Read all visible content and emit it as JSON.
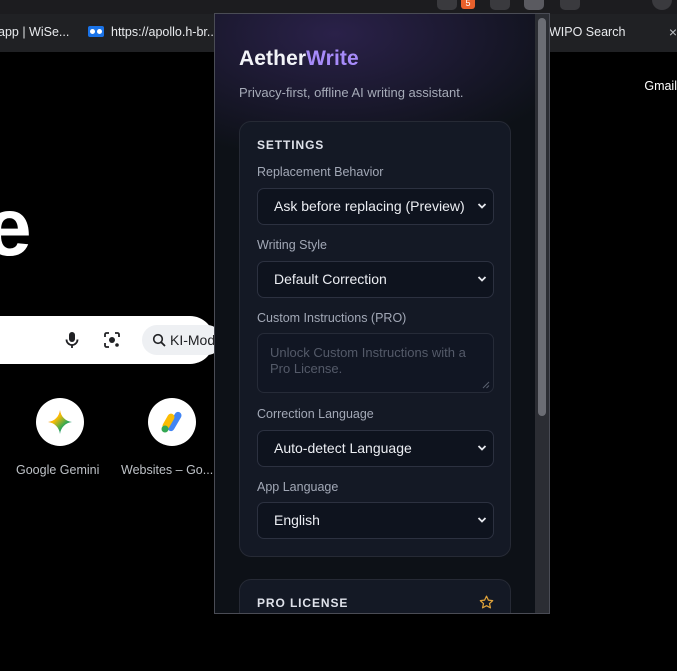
{
  "browser": {
    "extension_badge": "5",
    "bookmarks": [
      {
        "label": "app | WiSe..."
      },
      {
        "label": "https://apollo.h-br..."
      },
      {
        "label": "WIPO Search"
      }
    ],
    "close_symbol": "×",
    "gmail": "Gmail",
    "logo_letter": "e",
    "search_chip": "KI-Modus",
    "shortcuts": [
      {
        "label": "Google Gemini"
      },
      {
        "label": "Websites – Go..."
      }
    ]
  },
  "popup": {
    "brand_part1": "Aether",
    "brand_part2": "Write",
    "tagline": "Privacy-first, offline AI writing assistant.",
    "settings": {
      "title": "SETTINGS",
      "replacement_behavior": {
        "label": "Replacement Behavior",
        "value": "Ask before replacing (Preview)"
      },
      "writing_style": {
        "label": "Writing Style",
        "value": "Default Correction"
      },
      "custom_instructions": {
        "label": "Custom Instructions (PRO)",
        "placeholder": "Unlock Custom Instructions with a Pro License."
      },
      "correction_language": {
        "label": "Correction Language",
        "value": "Auto-detect Language"
      },
      "app_language": {
        "label": "App Language",
        "value": "English"
      }
    },
    "pro": {
      "title": "PRO LICENSE"
    }
  },
  "colors": {
    "accent": "#a78bfa",
    "background": "#0d1117",
    "card": "#141925",
    "star": "#e0a33a"
  },
  "icons": [
    "microphone-icon",
    "camera-search-icon",
    "magnify-sparkle-icon",
    "gemini-icon",
    "google-ads-icon",
    "chevron-down-icon",
    "star-icon"
  ]
}
